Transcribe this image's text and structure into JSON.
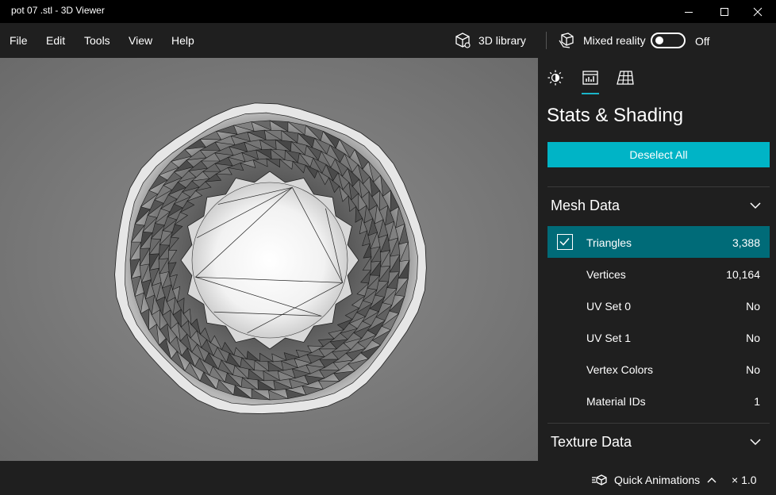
{
  "window": {
    "title": "pot 07 .stl - 3D Viewer"
  },
  "menu": {
    "file": "File",
    "edit": "Edit",
    "tools": "Tools",
    "view": "View",
    "help": "Help"
  },
  "toolbar": {
    "library_label": "3D library",
    "mixed_reality_label": "Mixed reality",
    "toggle_state": "Off"
  },
  "panel": {
    "tabs": [
      "lighting-icon",
      "stats-icon",
      "grid-icon"
    ],
    "title": "Stats & Shading",
    "deselect_label": "Deselect All",
    "mesh_section": "Mesh Data",
    "texture_section": "Texture Data",
    "rows": [
      {
        "label": "Triangles",
        "value": "3,388"
      },
      {
        "label": "Vertices",
        "value": "10,164"
      },
      {
        "label": "UV Set 0",
        "value": "No"
      },
      {
        "label": "UV Set 1",
        "value": "No"
      },
      {
        "label": "Vertex Colors",
        "value": "No"
      },
      {
        "label": "Material IDs",
        "value": "1"
      }
    ]
  },
  "bottom": {
    "quick_animations": "Quick Animations",
    "speed": "× 1.0"
  },
  "colors": {
    "accent": "#00b4c6",
    "selected_row": "#006b78",
    "background": "#1f1f1f"
  }
}
